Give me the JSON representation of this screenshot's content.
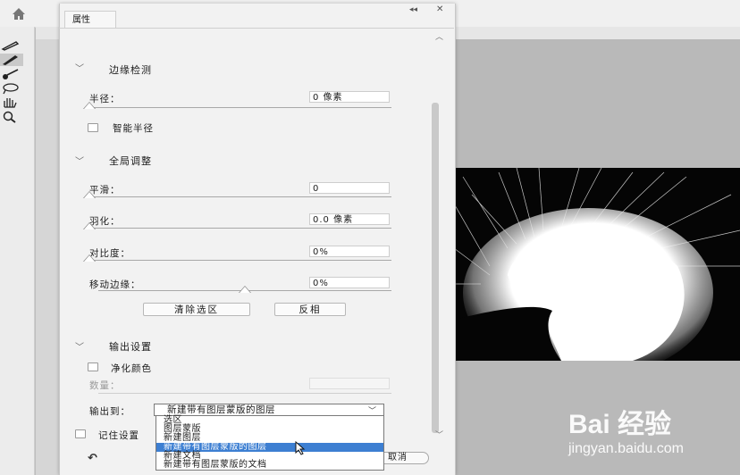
{
  "panel": {
    "tab_label": "属性",
    "collapse_glyph": "◂◂",
    "close_glyph": "✕"
  },
  "edge_detection": {
    "header": "边缘检测",
    "radius_label": "半径：",
    "radius_value": "0 像素",
    "radius_level": 0,
    "smart_radius_label": "智能半径",
    "smart_radius_checked": false
  },
  "global_refine": {
    "header": "全局调整",
    "smooth_label": "平滑：",
    "smooth_value": "0",
    "smooth_level": 0,
    "feather_label": "羽化：",
    "feather_value": "0.0 像素",
    "feather_level": 0,
    "contrast_label": "对比度：",
    "contrast_value": "0%",
    "contrast_level": 0,
    "shift_edge_label": "移动边缘：",
    "shift_edge_value": "0%",
    "shift_edge_level": 0.5,
    "clear_selection_button": "清除选区",
    "invert_button": "反相"
  },
  "output_settings": {
    "header": "输出设置",
    "decontaminate_label": "净化颜色",
    "decontaminate_checked": false,
    "amount_label": "数量：",
    "output_to_label": "输出到：",
    "output_to_value": "新建带有图层蒙版的图层",
    "options": [
      "选区",
      "图层蒙版",
      "新建图层",
      "新建带有图层蒙版的图层",
      "新建文档",
      "新建带有图层蒙版的文档"
    ],
    "selected_option_index": 3,
    "remember_label": "记住设置",
    "cancel_button": "取消"
  },
  "watermark": {
    "logo": "Bai 经验",
    "url": "jingyan.baidu.com"
  },
  "icons": [
    "home-icon",
    "brush-icon",
    "lasso-icon",
    "hand-icon",
    "zoom-icon",
    "chevron-down-icon",
    "undo-icon",
    "cursor-icon"
  ],
  "colors": {
    "selection_highlight": "#3d7fd2",
    "panel_bg": "#f2f2f2",
    "canvas_bg": "#b9b9b9"
  }
}
